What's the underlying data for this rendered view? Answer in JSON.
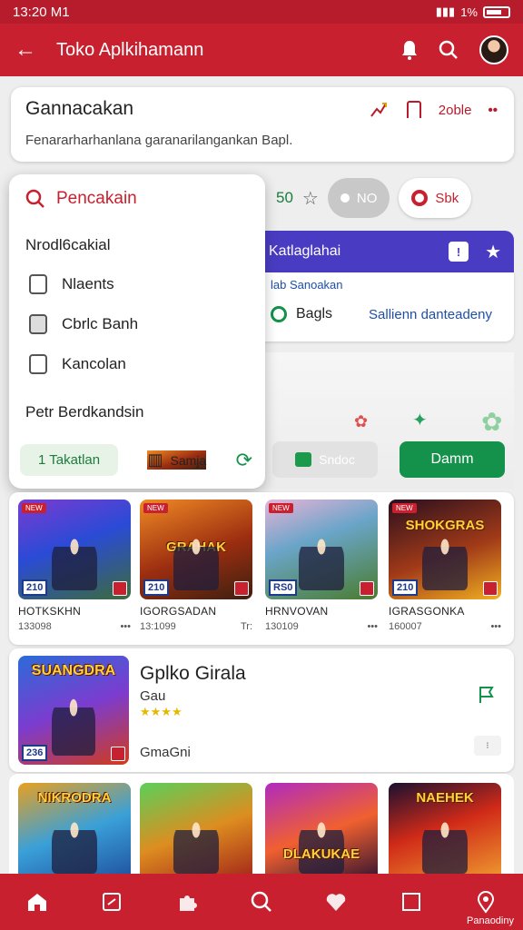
{
  "status": {
    "time": "13:20 M1",
    "right_text": "1%"
  },
  "appbar": {
    "title": "Toko Aplkihamann"
  },
  "header": {
    "title": "Gannacakan",
    "subtitle": "Fenararharhanlana garanarilangankan Bapl.",
    "count": "2oble"
  },
  "filters": {
    "number": "50",
    "toggle_label": "NO",
    "button_label": "Sbk"
  },
  "dropdown": {
    "search_label": "Pencakain",
    "section1": "Nrodl6cakial",
    "options": [
      "Nlaents",
      "Cbrlc Banh",
      "Kancolan"
    ],
    "section2": "Petr Berdkandsin",
    "footer_tag": "1 Takatlan",
    "footer_link": "Samja"
  },
  "purplebar": {
    "title": "Katlaglahai"
  },
  "info": {
    "small": "lab Sanoakan",
    "left": "Bagls",
    "right": "Sallienn danteadeny"
  },
  "banner": {
    "ghost_button": "Sndoc",
    "green_button": "Damm"
  },
  "games": [
    {
      "name": "HOTKSKHN",
      "meta": "133098",
      "num": "210",
      "tag": "NEW",
      "logo": "",
      "gradient": "g1"
    },
    {
      "name": "IGORGSADAN",
      "meta": "13:1099",
      "num": "210",
      "tag": "NEW",
      "logo": "GRAHAK",
      "gradient": "g2"
    },
    {
      "name": "HRNVOVAN",
      "meta": "130109",
      "num": "RS0",
      "tag": "NEW",
      "logo": "",
      "gradient": "g3"
    },
    {
      "name": "IGRASGONKA",
      "meta": "160007",
      "num": "210",
      "tag": "NEW",
      "logo": "SHOKGRAS",
      "gradient": "g4"
    }
  ],
  "featured": {
    "title": "Gplko Girala",
    "subtitle": "Gau",
    "stars": "★★★★",
    "developer": "GmaGni",
    "logo": "SUANGDRA",
    "num": "236"
  },
  "row4": [
    {
      "logo": "NIKRODRA",
      "gradient": "g6"
    },
    {
      "logo": "",
      "gradient": "g7"
    },
    {
      "logo": "DLAKUKAE",
      "gradient": "g8"
    },
    {
      "logo": "NAEHEK",
      "gradient": "g9"
    }
  ],
  "nav": {
    "label": "Panaodiny"
  },
  "colors": {
    "primary": "#c8202f",
    "green": "#14914a",
    "purple": "#4a3cc2"
  }
}
